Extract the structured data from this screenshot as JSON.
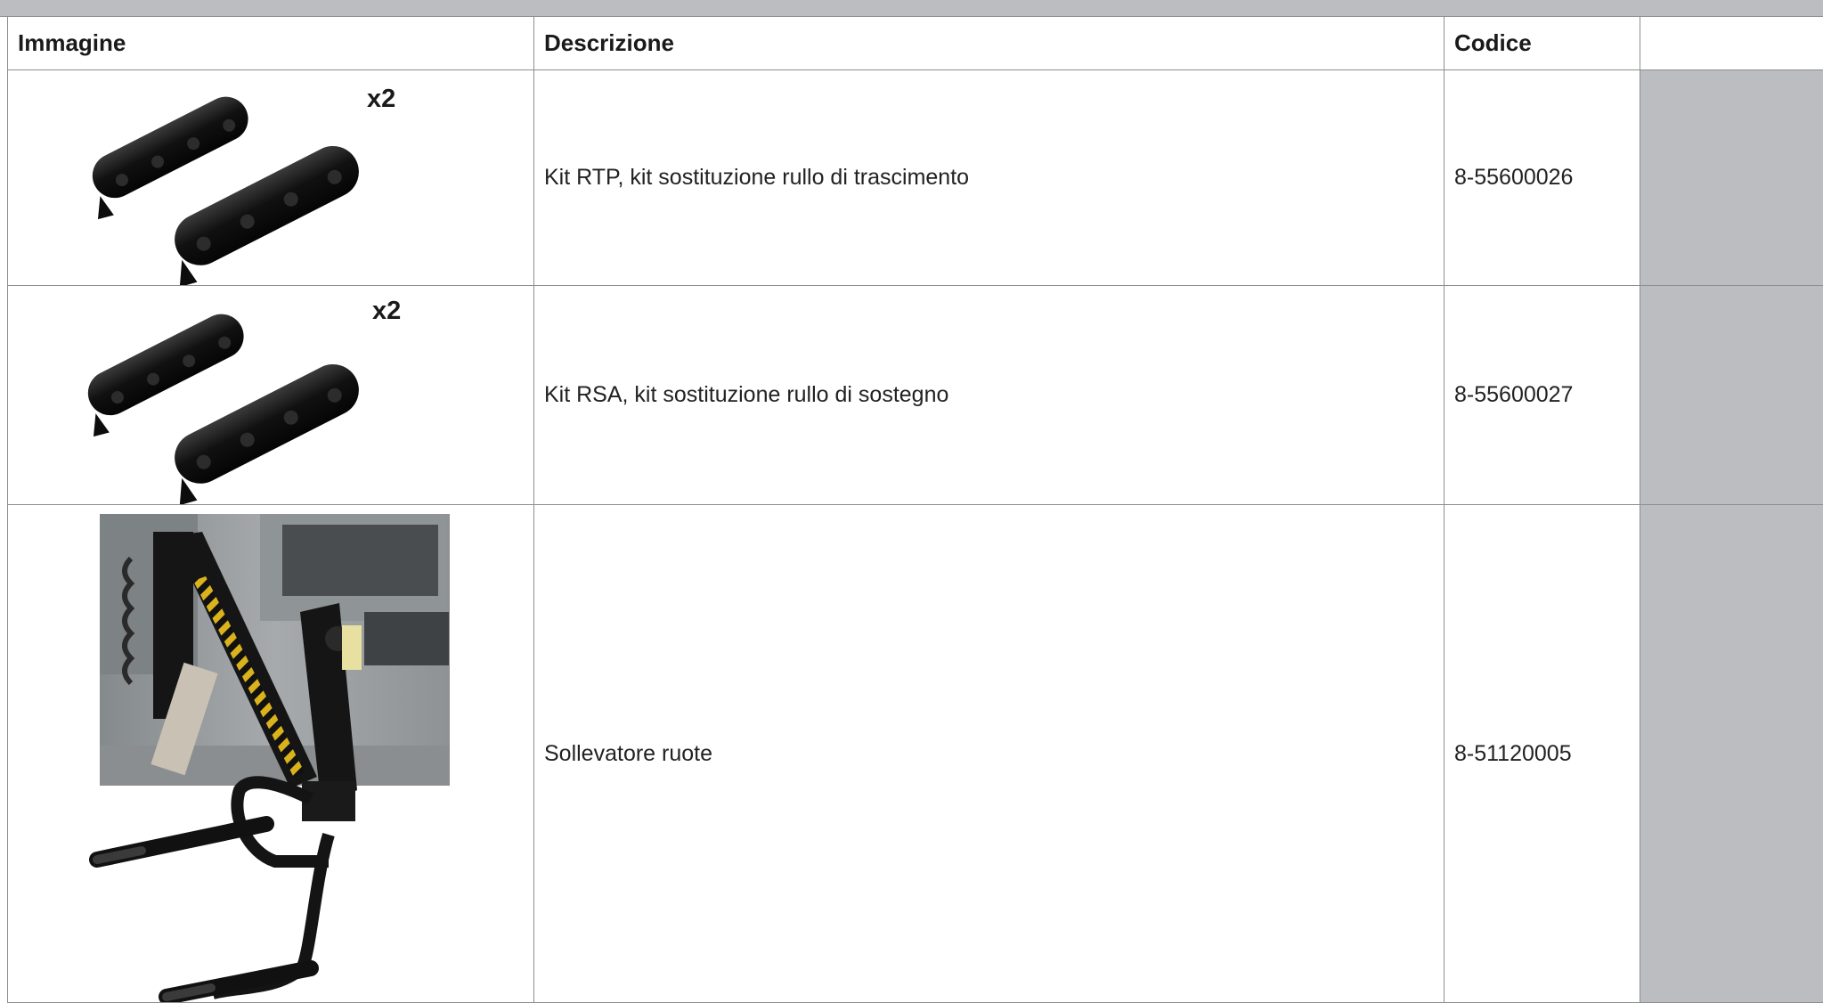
{
  "table": {
    "headers": [
      "Immagine",
      "Descrizione",
      "Codice",
      ""
    ],
    "rows": [
      {
        "quantity_label": "x2",
        "description": "Kit RTP, kit sostituzione rullo di trascimento",
        "code": "8-55600026"
      },
      {
        "quantity_label": "x2",
        "description": "Kit RSA, kit sostituzione rullo di sostegno",
        "code": "8-55600027"
      },
      {
        "description": "Sollevatore ruote",
        "code": "8-51120005"
      }
    ]
  },
  "colors": {
    "band": "#bcbdc0",
    "border": "#8d8e92",
    "roller": "#141414",
    "machine_gray": "#9ea2a4",
    "lifter_black": "#1a1a1a",
    "stripe_yellow": "#d9b21c"
  },
  "icons": [
    "roller-pad-image",
    "wheel-lifter-image"
  ]
}
